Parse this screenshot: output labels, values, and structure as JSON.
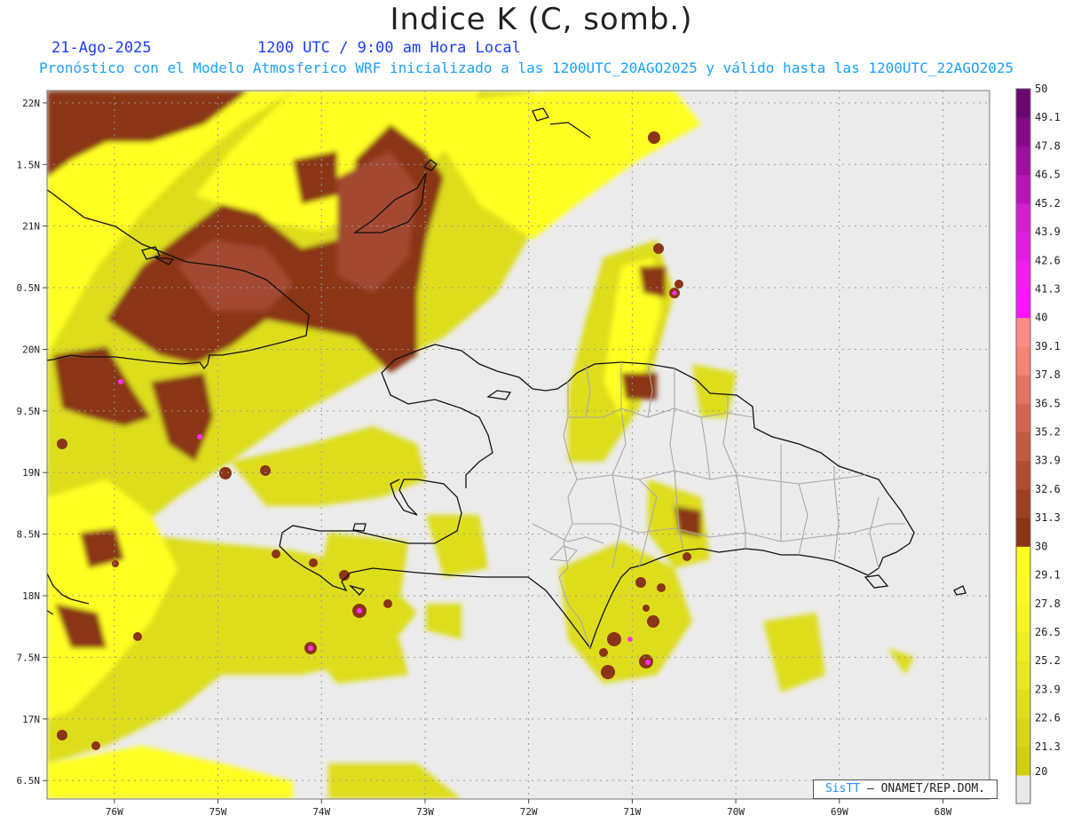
{
  "header": {
    "title": "Indice K (C, somb.)",
    "date": "21-Ago-2025",
    "time": "1200 UTC / 9:00 am Hora Local",
    "subtitle": "Pronóstico con el Modelo Atmosferico WRF inicializado a las 1200UTC_20AGO2025 y válido hasta las  1200UTC_22AGO2025"
  },
  "map": {
    "lon_range": [
      -76.65,
      -67.55
    ],
    "lat_range": [
      16.35,
      22.1
    ],
    "lat_ticks": [
      {
        "value": 22,
        "label": "22N"
      },
      {
        "value": 21.5,
        "label": "1.5N"
      },
      {
        "value": 21,
        "label": "21N"
      },
      {
        "value": 20.5,
        "label": "0.5N"
      },
      {
        "value": 20,
        "label": "20N"
      },
      {
        "value": 19.5,
        "label": "9.5N"
      },
      {
        "value": 19,
        "label": "19N"
      },
      {
        "value": 18.5,
        "label": "8.5N"
      },
      {
        "value": 18,
        "label": "18N"
      },
      {
        "value": 17.5,
        "label": "7.5N"
      },
      {
        "value": 17,
        "label": "17N"
      },
      {
        "value": 16.5,
        "label": "6.5N"
      }
    ],
    "lon_ticks": [
      {
        "value": -76,
        "label": "76W"
      },
      {
        "value": -75,
        "label": "75W"
      },
      {
        "value": -74,
        "label": "74W"
      },
      {
        "value": -73,
        "label": "73W"
      },
      {
        "value": -72,
        "label": "72W"
      },
      {
        "value": -71,
        "label": "71W"
      },
      {
        "value": -70,
        "label": "70W"
      },
      {
        "value": -69,
        "label": "69W"
      },
      {
        "value": -68,
        "label": "68W"
      }
    ],
    "colors": {
      "background": "#ebebeb",
      "grid": "#9a9a9a",
      "coast": "#111111",
      "borders": "#a8a8a8"
    }
  },
  "colorbar": {
    "levels": [
      {
        "label": "20",
        "color": "#c8c810"
      },
      {
        "label": "21.3",
        "color": "#cfcf14"
      },
      {
        "label": "22.6",
        "color": "#d6d61a"
      },
      {
        "label": "23.9",
        "color": "#dede1e"
      },
      {
        "label": "25.2",
        "color": "#e6e624"
      },
      {
        "label": "26.5",
        "color": "#eeee26"
      },
      {
        "label": "27.8",
        "color": "#f5f528"
      },
      {
        "label": "29.1",
        "color": "#fafa28"
      },
      {
        "label": "30",
        "color": "#ffff1e"
      },
      {
        "label": "31.3",
        "color": "#8a3414"
      },
      {
        "label": "32.6",
        "color": "#9e4022"
      },
      {
        "label": "33.9",
        "color": "#b04c32"
      },
      {
        "label": "35.2",
        "color": "#c25a42"
      },
      {
        "label": "36.5",
        "color": "#d26650"
      },
      {
        "label": "37.8",
        "color": "#e47464"
      },
      {
        "label": "39.1",
        "color": "#f48474"
      },
      {
        "label": "40",
        "color": "#ff8c8c"
      },
      {
        "label": "41.3",
        "color": "#ff14ff"
      },
      {
        "label": "42.6",
        "color": "#f01ef0"
      },
      {
        "label": "43.9",
        "color": "#e21ee2"
      },
      {
        "label": "45.2",
        "color": "#d01ed0"
      },
      {
        "label": "46.5",
        "color": "#b814b8"
      },
      {
        "label": "47.8",
        "color": "#9e0ea0"
      },
      {
        "label": "49.1",
        "color": "#860a88"
      },
      {
        "label": "50",
        "color": "#6a0870"
      }
    ],
    "below_color": "#e8e8e8"
  },
  "field_colors": {
    "high": "#8a3516",
    "high_mid": "#a34a33",
    "peak": "#ff2cff",
    "yellow": "#ffff22",
    "olive": "#dddd1c"
  },
  "credit": {
    "brand": "SisTT",
    "text": "– ONAMET/REP.DOM."
  }
}
